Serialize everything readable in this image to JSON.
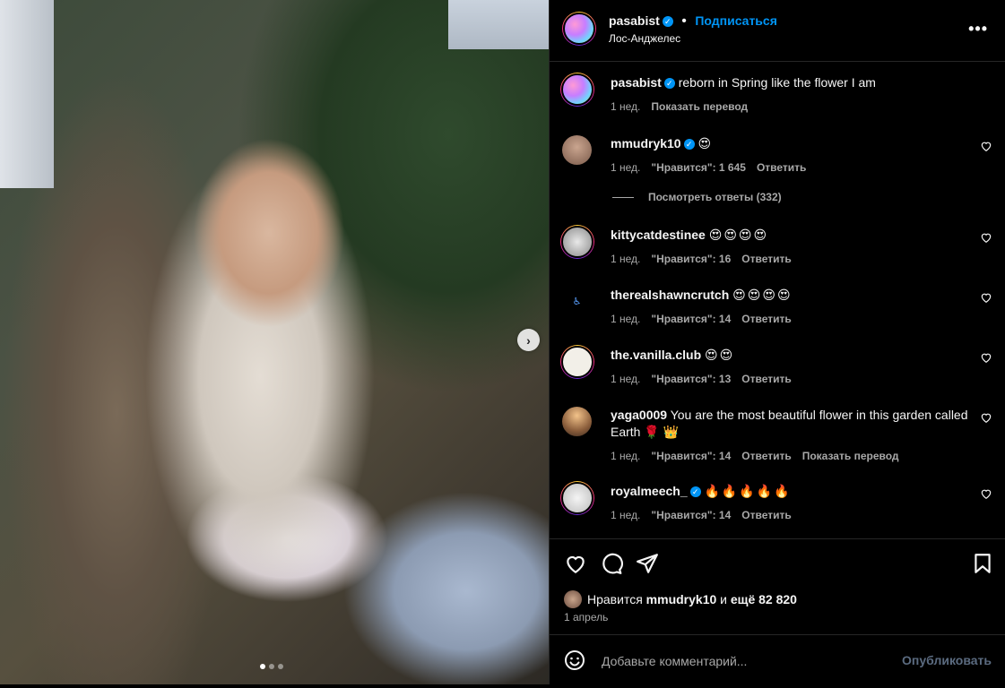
{
  "post": {
    "username": "pasabist",
    "follow_label": "Подписаться",
    "location": "Лос-Анджелес",
    "more_label": "•••",
    "caption": "reborn in Spring like the flower I am",
    "caption_time": "1 нед.",
    "caption_translate": "Показать перевод",
    "carousel_dots": 3,
    "carousel_active": 1
  },
  "comments": [
    {
      "user": "mmudryk10",
      "verified": true,
      "text": "😍",
      "time": "1 нед.",
      "likes": "\"Нравится\": 1 645",
      "reply": "Ответить",
      "translate": ""
    },
    {
      "user": "kittycatdestinee",
      "verified": false,
      "text": "😍😍😍😍",
      "time": "1 нед.",
      "likes": "\"Нравится\": 16",
      "reply": "Ответить",
      "translate": ""
    },
    {
      "user": "therealshawncrutch",
      "verified": false,
      "text": "😍😍😍😍",
      "time": "1 нед.",
      "likes": "\"Нравится\": 14",
      "reply": "Ответить",
      "translate": ""
    },
    {
      "user": "the.vanilla.club",
      "verified": false,
      "text": "😍😍",
      "time": "1 нед.",
      "likes": "\"Нравится\": 13",
      "reply": "Ответить",
      "translate": ""
    },
    {
      "user": "yaga0009",
      "verified": false,
      "text": "You are the most beautiful flower in this garden called Earth 🌹 👑",
      "time": "1 нед.",
      "likes": "\"Нравится\": 14",
      "reply": "Ответить",
      "translate": "Показать перевод"
    },
    {
      "user": "royalmeech_",
      "verified": true,
      "text": "🔥🔥🔥🔥🔥",
      "time": "1 нед.",
      "likes": "\"Нравится\": 14",
      "reply": "Ответить",
      "translate": ""
    }
  ],
  "view_replies": "Посмотреть ответы (332)",
  "likes_line": {
    "prefix": "Нравится",
    "user": "mmudryk10",
    "middle": "и",
    "rest": "ещё 82 820"
  },
  "post_date": "1 апрель",
  "composer": {
    "placeholder": "Добавьте комментарий...",
    "publish": "Опубликовать"
  }
}
